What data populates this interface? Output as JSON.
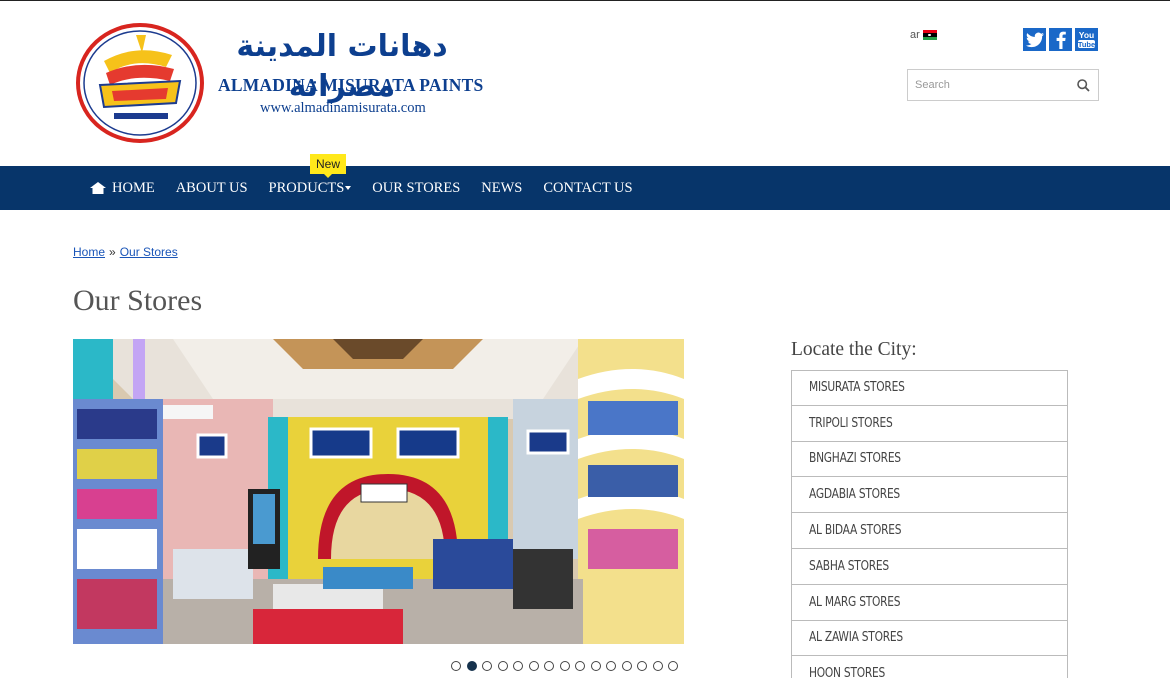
{
  "header": {
    "logo_arabic": "دهانات المدينة مصراتة",
    "logo_english": "ALMADINA MISURATA PAINTS",
    "logo_url_text": "www.almadinamisurata.com",
    "language_label": "ar",
    "social": {
      "youtube_text": "You\nTube"
    },
    "search": {
      "placeholder": "Search"
    }
  },
  "nav": {
    "items": [
      {
        "label": "HOME"
      },
      {
        "label": "ABOUT US"
      },
      {
        "label": "PRODUCTS"
      },
      {
        "label": "OUR STORES"
      },
      {
        "label": "NEWS"
      },
      {
        "label": "CONTACT US"
      }
    ],
    "badge": "New"
  },
  "breadcrumb": {
    "home": "Home",
    "separator": "»",
    "current": "Our Stores"
  },
  "page": {
    "title": "Our Stores"
  },
  "slider": {
    "slide_count": 15,
    "active_index": 1
  },
  "sidebar": {
    "title": "Locate the City:",
    "cities": [
      "MISURATA STORES",
      "TRIPOLI STORES",
      "BNGHAZI STORES",
      "AGDABIA STORES",
      "AL BIDAA STORES",
      "SABHA STORES",
      "AL MARG STORES",
      "AL ZAWIA STORES",
      "HOON STORES"
    ]
  },
  "colors": {
    "nav_bg": "#07356a",
    "brand_blue": "#0d3f8f",
    "badge_yellow": "#ffe81a",
    "social_blue": "#1a68c8"
  }
}
